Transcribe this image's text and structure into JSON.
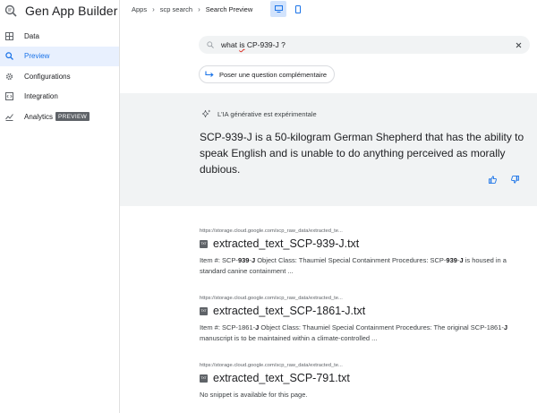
{
  "app": {
    "title": "Gen App Builder"
  },
  "sidebar": {
    "items": [
      {
        "label": "Data"
      },
      {
        "label": "Preview"
      },
      {
        "label": "Configurations"
      },
      {
        "label": "Integration"
      },
      {
        "label": "Analytics",
        "badge": "PREVIEW"
      }
    ]
  },
  "breadcrumb": [
    "Apps",
    "scp search",
    "Search Preview"
  ],
  "search": {
    "query_pre": "what ",
    "query_underlined": "is",
    "query_post": " CP-939-J ?"
  },
  "followup": {
    "label": "Poser une question complémentaire"
  },
  "ai": {
    "heading": "L'IA générative est expérimentale",
    "answer": "SCP-939-J is a 50-kilogram German Shepherd that has the ability to speak English and is unable to do anything perceived as morally dubious."
  },
  "results": [
    {
      "url": "https://storage.cloud.google.com/scp_raw_data/extracted_te...",
      "title": "extracted_text_SCP-939-J.txt",
      "snippet": [
        {
          "t": "Item #: SCP-"
        },
        {
          "t": "939",
          "b": true
        },
        {
          "t": "-"
        },
        {
          "t": "J",
          "b": true
        },
        {
          "t": " Object Class: Thaumiel Special Containment Procedures: SCP-"
        },
        {
          "t": "939",
          "b": true
        },
        {
          "t": "-"
        },
        {
          "t": "J",
          "b": true
        },
        {
          "t": " is housed in a standard canine containment ..."
        }
      ]
    },
    {
      "url": "https://storage.cloud.google.com/scp_raw_data/extracted_te...",
      "title": "extracted_text_SCP-1861-J.txt",
      "snippet": [
        {
          "t": "Item #: SCP-1861-"
        },
        {
          "t": "J",
          "b": true
        },
        {
          "t": " Object Class: Thaumiel Special Containment Procedures: The original SCP-1861-"
        },
        {
          "t": "J",
          "b": true
        },
        {
          "t": " manuscript is to be maintained within a climate-controlled ..."
        }
      ]
    },
    {
      "url": "https://storage.cloud.google.com/scp_raw_data/extracted_te...",
      "title": "extracted_text_SCP-791.txt",
      "snippet": [
        {
          "t": "No snippet is available for this page."
        }
      ]
    }
  ],
  "colors": {
    "accent": "#1a73e8",
    "active_bg": "#e8f0fe",
    "panel_bg": "#f1f3f4"
  }
}
